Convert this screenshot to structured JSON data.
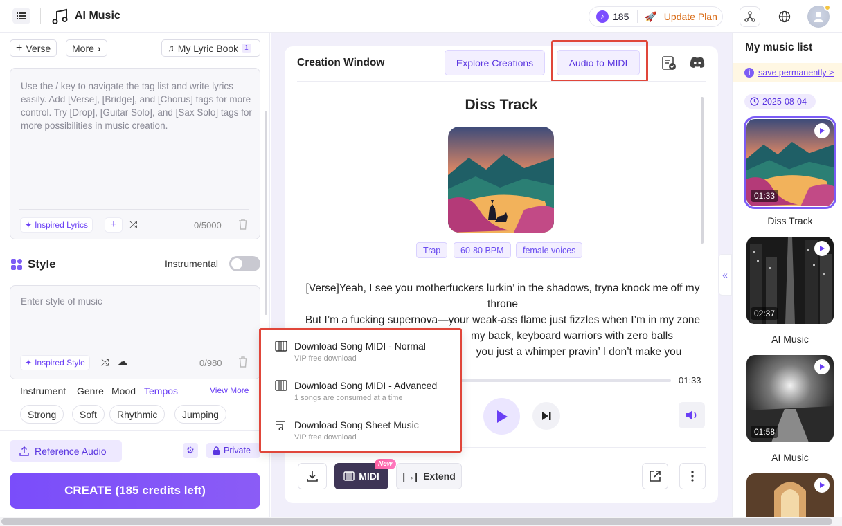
{
  "header": {
    "app_title": "AI Music",
    "credits": "185",
    "update_plan": "Update Plan"
  },
  "lyrics_panel": {
    "verse_btn": "Verse",
    "more_btn": "More",
    "lyric_book": "My Lyric Book",
    "lyric_book_count": "1",
    "placeholder": "Use the / key to navigate the tag list and write lyrics easily. Add [Verse], [Bridge], and [Chorus] tags for more control. Try [Drop], [Guitar Solo], and [Sax Solo] tags for more possibilities in music creation.",
    "inspired_lyrics": "Inspired Lyrics",
    "counter": "0/5000"
  },
  "style_panel": {
    "title": "Style",
    "instrumental": "Instrumental",
    "instrumental_on": false,
    "placeholder": "Enter style of music",
    "inspired_style": "Inspired Style",
    "counter": "0/980",
    "tabs": [
      "Instrument",
      "Genre",
      "Mood",
      "Tempos"
    ],
    "active_tab": "Tempos",
    "view_more": "View More",
    "tags": [
      "Strong",
      "Soft",
      "Rhythmic",
      "Jumping"
    ]
  },
  "left_footer": {
    "reference_audio": "Reference Audio",
    "private": "Private",
    "create": "CREATE (185 credits left)"
  },
  "creation_window": {
    "title": "Creation Window",
    "explore_btn": "Explore Creations",
    "audio_to_midi_btn": "Audio to MIDI",
    "song_title": "Diss Track",
    "tags": [
      "Trap",
      "60-80 BPM",
      "female voices"
    ],
    "lyrics_lines": [
      "[Verse]Yeah, I see you motherfuckers lurkin’ in the shadows, tryna knock me off my throne",
      "But I’m a fucking supernova—your weak-ass flame just fizzles when I’m in my zone",
      "my back, keyboard warriors with zero balls",
      "you just a whimper   pravin’ I don’t make you"
    ],
    "duration": "01:33",
    "midi_btn": "MIDI",
    "new_badge": "New",
    "extend_btn": "Extend"
  },
  "midi_menu": {
    "items": [
      {
        "title": "Download Song MIDI - Normal",
        "subtitle": "VIP free download"
      },
      {
        "title": "Download Song MIDI - Advanced",
        "subtitle": "1 songs are consumed at a time"
      },
      {
        "title": "Download Song Sheet Music",
        "subtitle": "VIP free download"
      }
    ]
  },
  "music_list": {
    "title": "My music list",
    "save_banner": "save permanently >",
    "date": "2025-08-04",
    "songs": [
      {
        "name": "Diss Track",
        "duration": "01:33"
      },
      {
        "name": "AI Music",
        "duration": "02:37"
      },
      {
        "name": "AI Music",
        "duration": "01:58"
      },
      {
        "name": "",
        "duration": ""
      }
    ]
  }
}
